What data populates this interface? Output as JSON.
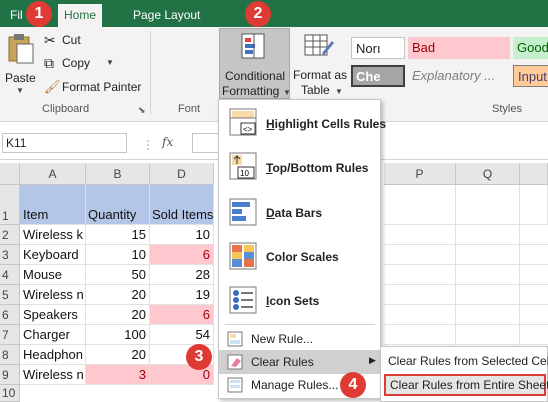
{
  "tabs": [
    {
      "label": "File",
      "visible_text": "Fil"
    },
    {
      "label": "Home"
    },
    {
      "label": "Insert Page Layout",
      "visible_text": "Insert Page Layout"
    }
  ],
  "tab_partial": "Fil",
  "tab_home": "Home",
  "tab_layout": "Page Layout",
  "ribbon": {
    "paste": "Paste",
    "cut": "Cut",
    "copy": "Copy",
    "format_painter": "Format Painter",
    "clipboard_group": "Clipboard",
    "font_group": "Font",
    "conditional_formatting_1": "Conditional",
    "conditional_formatting_2": "Formatting",
    "format_as_table_1": "Format as",
    "format_as_table_2": "Table",
    "styles_group": "Styles",
    "styles": {
      "normal": "Norı",
      "bad": "Bad",
      "good": "Good",
      "check": "Che",
      "explanatory": "Explanatory ...",
      "input": "Input"
    }
  },
  "formula_bar": {
    "name_box": "K11",
    "fx": "fx"
  },
  "columns": [
    "A",
    "B",
    "D",
    "P",
    "Q"
  ],
  "rows": [
    "1",
    "2",
    "3",
    "4",
    "5",
    "6",
    "7",
    "8",
    "9",
    "10"
  ],
  "table": {
    "headers": [
      "Item",
      "Quantity",
      "Sold Items"
    ],
    "rows": [
      {
        "item": "Wireless k",
        "qty": "15",
        "sold": "10"
      },
      {
        "item": "Keyboard",
        "qty": "10",
        "sold": "6"
      },
      {
        "item": "Mouse",
        "qty": "50",
        "sold": "28"
      },
      {
        "item": "Wireless n",
        "qty": "20",
        "sold": "19"
      },
      {
        "item": "Speakers",
        "qty": "20",
        "sold": "6"
      },
      {
        "item": "Charger",
        "qty": "100",
        "sold": "54"
      },
      {
        "item": "Headphon",
        "qty": "20",
        "sold": ""
      },
      {
        "item": "Wireless n",
        "qty": "3",
        "sold": "0"
      }
    ]
  },
  "menu": {
    "highlight": "Highlight Cells Rules",
    "topbottom": "Top/Bottom Rules",
    "databars": "Data Bars",
    "colorscales": "Color Scales",
    "iconsets": "Icon Sets",
    "newrule": "New Rule...",
    "clearrules": "Clear Rules",
    "managerules": "Manage Rules..."
  },
  "submenu": {
    "selected": "Clear Rules from Selected Cells",
    "entire": "Clear Rules from Entire Sheet"
  },
  "badges": [
    "1",
    "2",
    "3",
    "4"
  ],
  "colors": {
    "excel_green": "#217346",
    "badge_red": "#e03a34",
    "header_blue": "#b4c6e7",
    "bad_pink": "#ffc7ce"
  }
}
